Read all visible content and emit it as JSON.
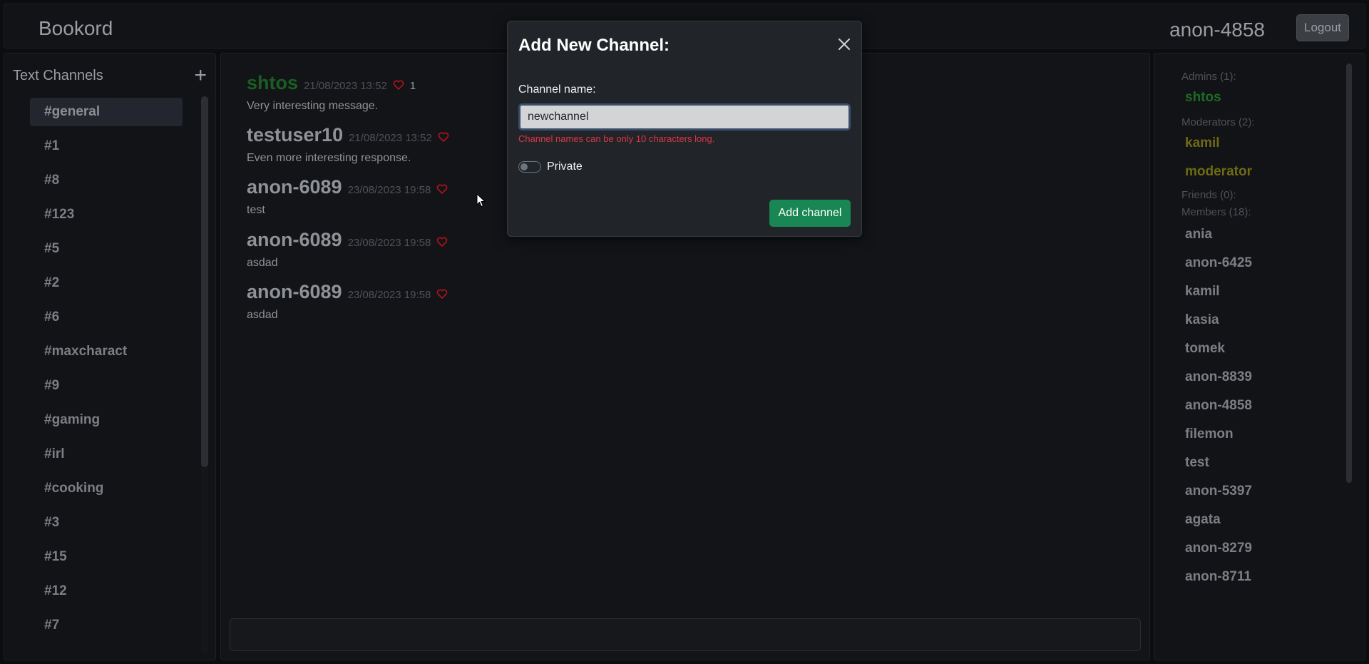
{
  "header": {
    "brand": "Bookord",
    "username": "anon-4858",
    "logout_label": "Logout"
  },
  "sidebar": {
    "title": "Text Channels",
    "add_symbol": "+",
    "channels": [
      "#general",
      "#1",
      "#8",
      "#123",
      "#5",
      "#2",
      "#6",
      "#maxcharact",
      "#9",
      "#gaming",
      "#irl",
      "#cooking",
      "#3",
      "#15",
      "#12",
      "#7"
    ],
    "active_channel": "#general"
  },
  "messages": [
    {
      "author": "shtos",
      "time": "21/08/2023 13:52",
      "likes": "1",
      "text": "Very interesting message.",
      "role": "admin"
    },
    {
      "author": "testuser10",
      "time": "21/08/2023 13:52",
      "likes": "",
      "text": "Even more interesting response.",
      "role": "member"
    },
    {
      "author": "anon-6089",
      "time": "23/08/2023 19:58",
      "likes": "",
      "text": "test",
      "role": "member"
    },
    {
      "author": "anon-6089",
      "time": "23/08/2023 19:58",
      "likes": "",
      "text": "asdad",
      "role": "member"
    },
    {
      "author": "anon-6089",
      "time": "23/08/2023 19:58",
      "likes": "",
      "text": "asdad",
      "role": "member"
    }
  ],
  "members_panel": {
    "admins_title": "Admins (1):",
    "admins": [
      "shtos"
    ],
    "moderators_title": "Moderators (2):",
    "moderators": [
      "kamil",
      "moderator"
    ],
    "friends_title": "Friends (0):",
    "members_title": "Members (18):",
    "members": [
      "ania",
      "anon-6425",
      "kamil",
      "kasia",
      "tomek",
      "anon-8839",
      "anon-4858",
      "filemon",
      "test",
      "anon-5397",
      "agata",
      "anon-8279",
      "anon-8711"
    ]
  },
  "modal": {
    "title": "Add New Channel:",
    "name_label": "Channel name:",
    "name_value": "newchannel",
    "error": "Channel names can be only 10 characters long.",
    "private_label": "Private",
    "private_checked": false,
    "submit_label": "Add channel"
  },
  "colors": {
    "accent_green": "#198754",
    "error_red": "#dc3545",
    "admin_green": "#1c6b24",
    "moderator_olive": "#6e6a14",
    "like_red": "#b5121b"
  }
}
